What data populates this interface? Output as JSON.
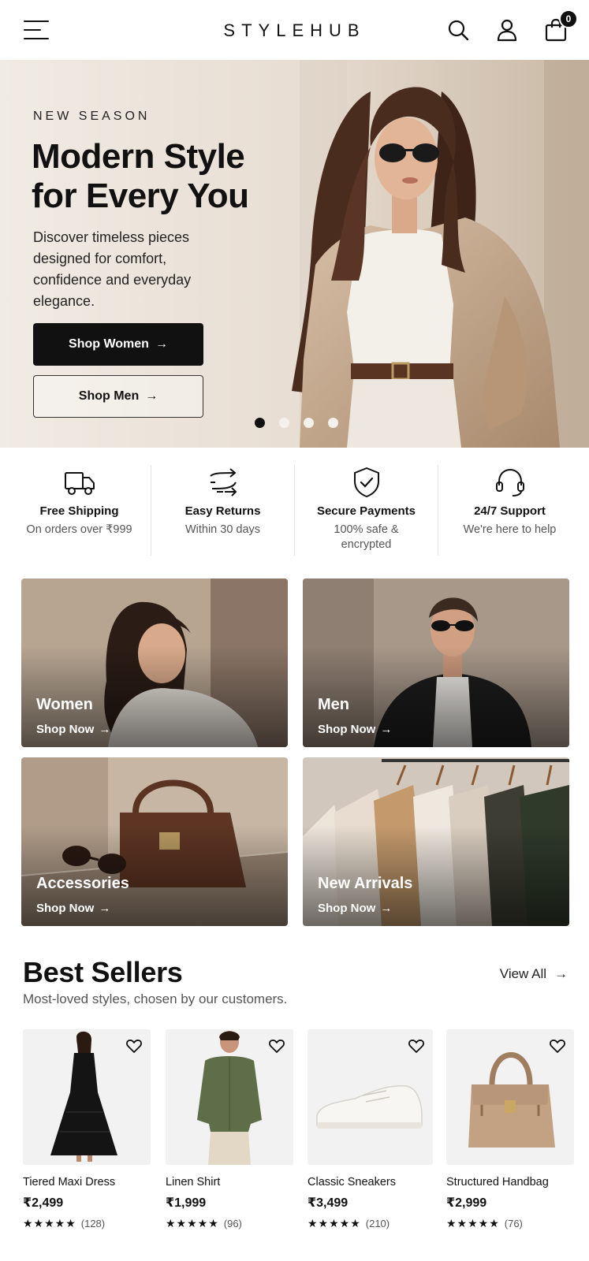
{
  "header": {
    "logo": "STYLEHUB",
    "cart_count": "0",
    "icons": [
      "menu-icon",
      "search-icon",
      "user-icon",
      "bag-icon"
    ]
  },
  "hero": {
    "eyebrow": "NEW SEASON",
    "title": "Modern Style for Every You",
    "description": "Discover timeless pieces designed for comfort, confidence and everyday elegance.",
    "primary_button": "Shop Women",
    "secondary_button": "Shop Men",
    "slides": 4,
    "active_slide": 1
  },
  "features": [
    {
      "title": "Free Shipping",
      "subtitle": "On orders over ₹999",
      "icon": "truck-icon"
    },
    {
      "title": "Easy Returns",
      "subtitle": "Within 30 days",
      "icon": "returns-icon"
    },
    {
      "title": "Secure Payments",
      "subtitle": "100% safe & encrypted",
      "icon": "shield-icon"
    },
    {
      "title": "24/7 Support",
      "subtitle": "We're here to help",
      "icon": "headset-icon"
    }
  ],
  "categories": [
    {
      "name": "Women",
      "cta": "Shop Now"
    },
    {
      "name": "Men",
      "cta": "Shop Now"
    },
    {
      "name": "Accessories",
      "cta": "Shop Now"
    },
    {
      "name": "New Arrivals",
      "cta": "Shop Now"
    }
  ],
  "best_sellers": {
    "title": "Best Sellers",
    "subtitle": "Most-loved styles, chosen by our customers.",
    "view_all": "View All",
    "products": [
      {
        "name": "Tiered Maxi Dress",
        "price": "₹2,499",
        "stars": "★★★★★",
        "reviews": "(128)",
        "rating": 4.5
      },
      {
        "name": "Linen Shirt",
        "price": "₹1,999",
        "stars": "★★★★★",
        "reviews": "(96)",
        "rating": 4.5
      },
      {
        "name": "Classic Sneakers",
        "price": "₹3,499",
        "stars": "★★★★★",
        "reviews": "(210)",
        "rating": 4.5
      },
      {
        "name": "Structured Handbag",
        "price": "₹2,999",
        "stars": "★★★★★",
        "reviews": "(76)",
        "rating": 4.5
      }
    ]
  },
  "colors": {
    "primary": "#111111",
    "hero_bg": "#e9e1d8",
    "text_muted": "#555555"
  }
}
